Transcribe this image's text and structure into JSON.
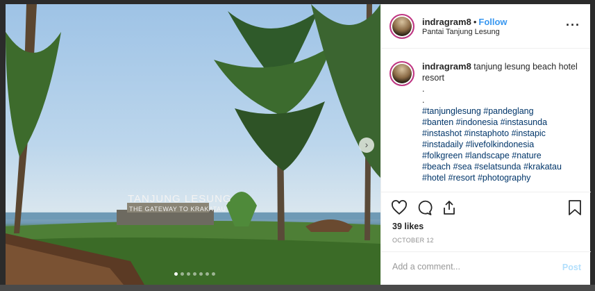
{
  "post": {
    "username": "indragram8",
    "separator": "•",
    "follow_label": "Follow",
    "location": "Pantai Tanjung Lesung",
    "more_icon": "more-horizontal-icon"
  },
  "photo": {
    "sign_text": "TANJUNG LESUNG",
    "sign_subtext": "THE GATEWAY TO KRAKATAU",
    "next_icon": "chevron-right-icon",
    "slide_count": 7,
    "current_slide": 1
  },
  "caption": {
    "username": "indragram8",
    "text": "tanjung lesung beach hotel resort",
    "spacer1": ".",
    "spacer2": ".",
    "hashtags": [
      "#tanjunglesung",
      "#pandeglang",
      "#banten",
      "#indonesia",
      "#instasunda",
      "#instashot",
      "#instaphoto",
      "#instapic",
      "#instadaily",
      "#livefolkindonesia",
      "#folkgreen",
      "#landscape",
      "#nature",
      "#beach",
      "#sea",
      "#selatsunda",
      "#krakatau",
      "#hotel",
      "#resort",
      "#photography"
    ]
  },
  "actions": {
    "like_icon": "heart-icon",
    "comment_icon": "comment-icon",
    "share_icon": "share-icon",
    "save_icon": "bookmark-icon",
    "likes": "39 likes",
    "date": "OCTOBER 12"
  },
  "comment": {
    "placeholder": "Add a comment...",
    "post_label": "Post"
  }
}
